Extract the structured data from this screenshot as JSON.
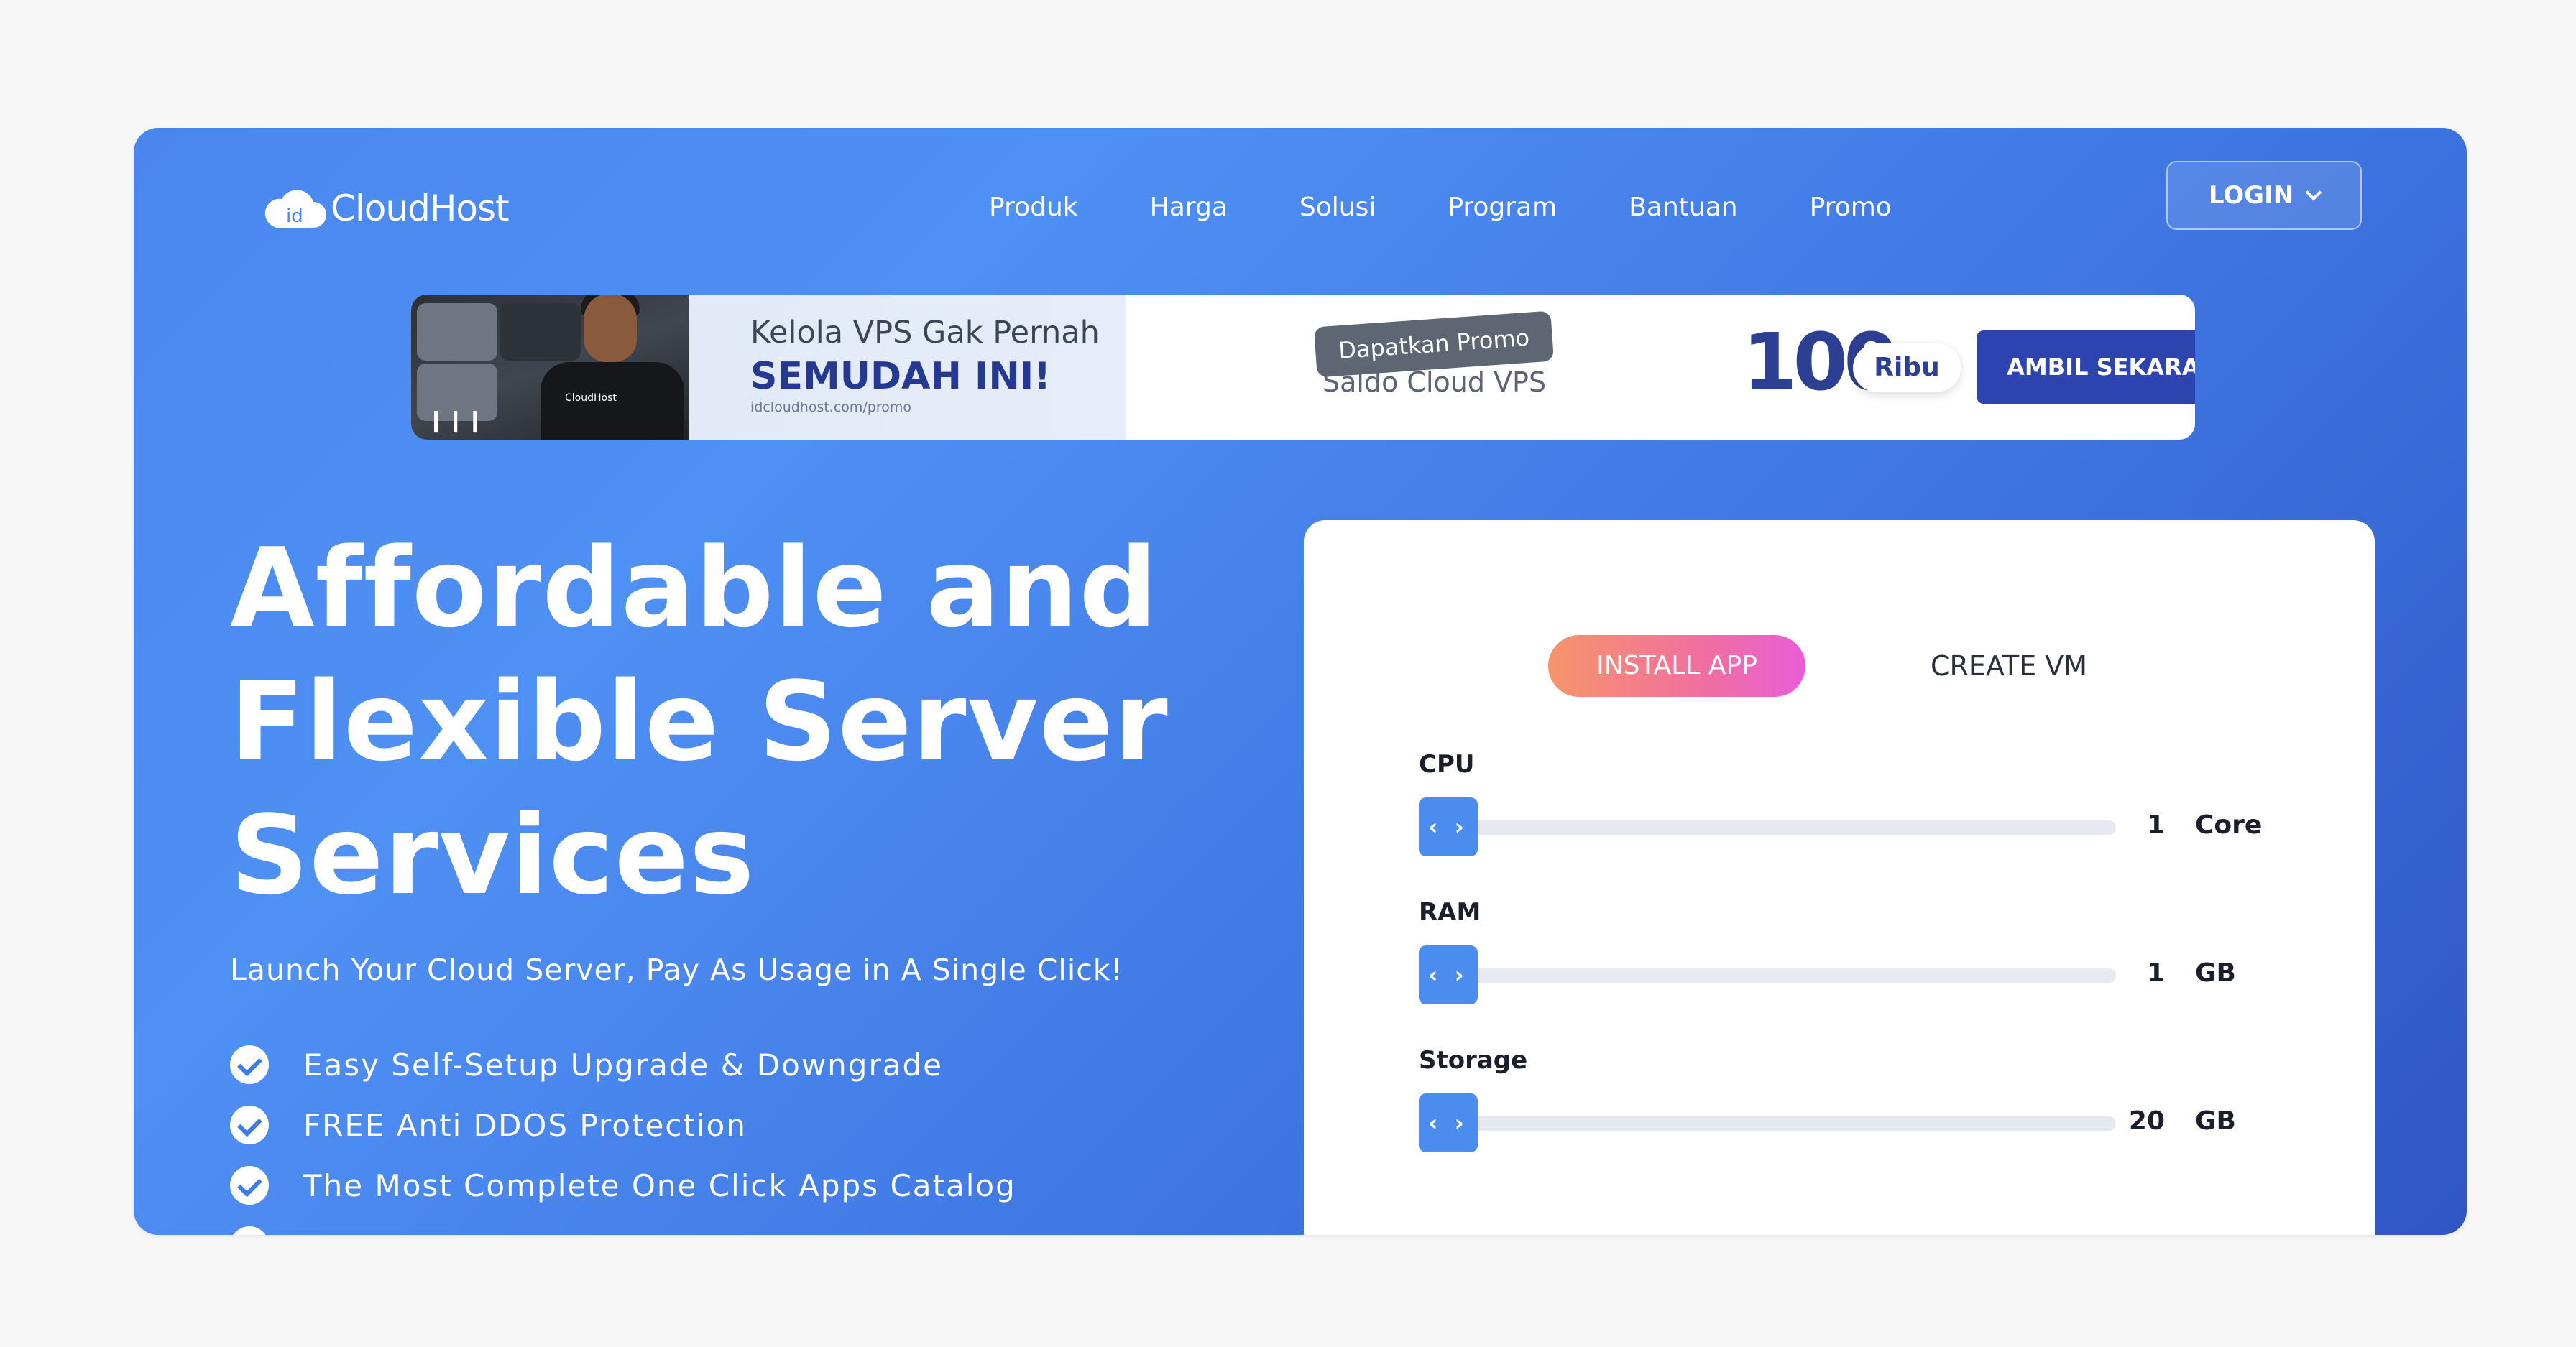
{
  "brand": {
    "logo_badge": "id",
    "name": "CloudHost"
  },
  "nav": {
    "items": [
      {
        "label": "Produk"
      },
      {
        "label": "Harga"
      },
      {
        "label": "Solusi"
      },
      {
        "label": "Program"
      },
      {
        "label": "Bantuan"
      },
      {
        "label": "Promo"
      }
    ],
    "login_label": "LOGIN"
  },
  "banner": {
    "line1": "Kelola VPS Gak Pernah",
    "line2": "SEMUDAH INI!",
    "url": "idcloudhost.com/promo",
    "badge": "Dapatkan Promo",
    "subtitle": "Saldo Cloud VPS",
    "amount": "100",
    "amount_unit": "Ribu",
    "cta": "AMBIL SEKARANG ›",
    "shirt_logo": "CloudHost"
  },
  "hero": {
    "title_lines": [
      "Affordable and",
      "Flexible Server",
      "Services"
    ],
    "subtitle": "Launch Your Cloud Server, Pay As Usage in A Single Click!",
    "features": [
      "Easy Self-Setup Upgrade & Downgrade",
      "FREE Anti DDOS Protection",
      "The Most Complete One Click Apps Catalog"
    ]
  },
  "configurator": {
    "tabs": {
      "install": "INSTALL APP",
      "create": "CREATE VM"
    },
    "resources": [
      {
        "label": "CPU",
        "value": "1",
        "unit": "Core"
      },
      {
        "label": "RAM",
        "value": "1",
        "unit": "GB"
      },
      {
        "label": "Storage",
        "value": "20",
        "unit": "GB"
      }
    ]
  },
  "colors": {
    "hero_gradient_start": "#4f90f4",
    "hero_gradient_end": "#2f56c4",
    "cta_blue": "#2c43b0",
    "install_tab_gradient": [
      "#f6956a",
      "#e95dd8"
    ],
    "slider_handle": "#4b8cef"
  },
  "icons": {
    "logo": "cloud-logo-icon",
    "login_chevron": "chevron-down-icon",
    "feature_check": "check-circle-icon",
    "slider_handle": "chevron-left-right-icon"
  }
}
